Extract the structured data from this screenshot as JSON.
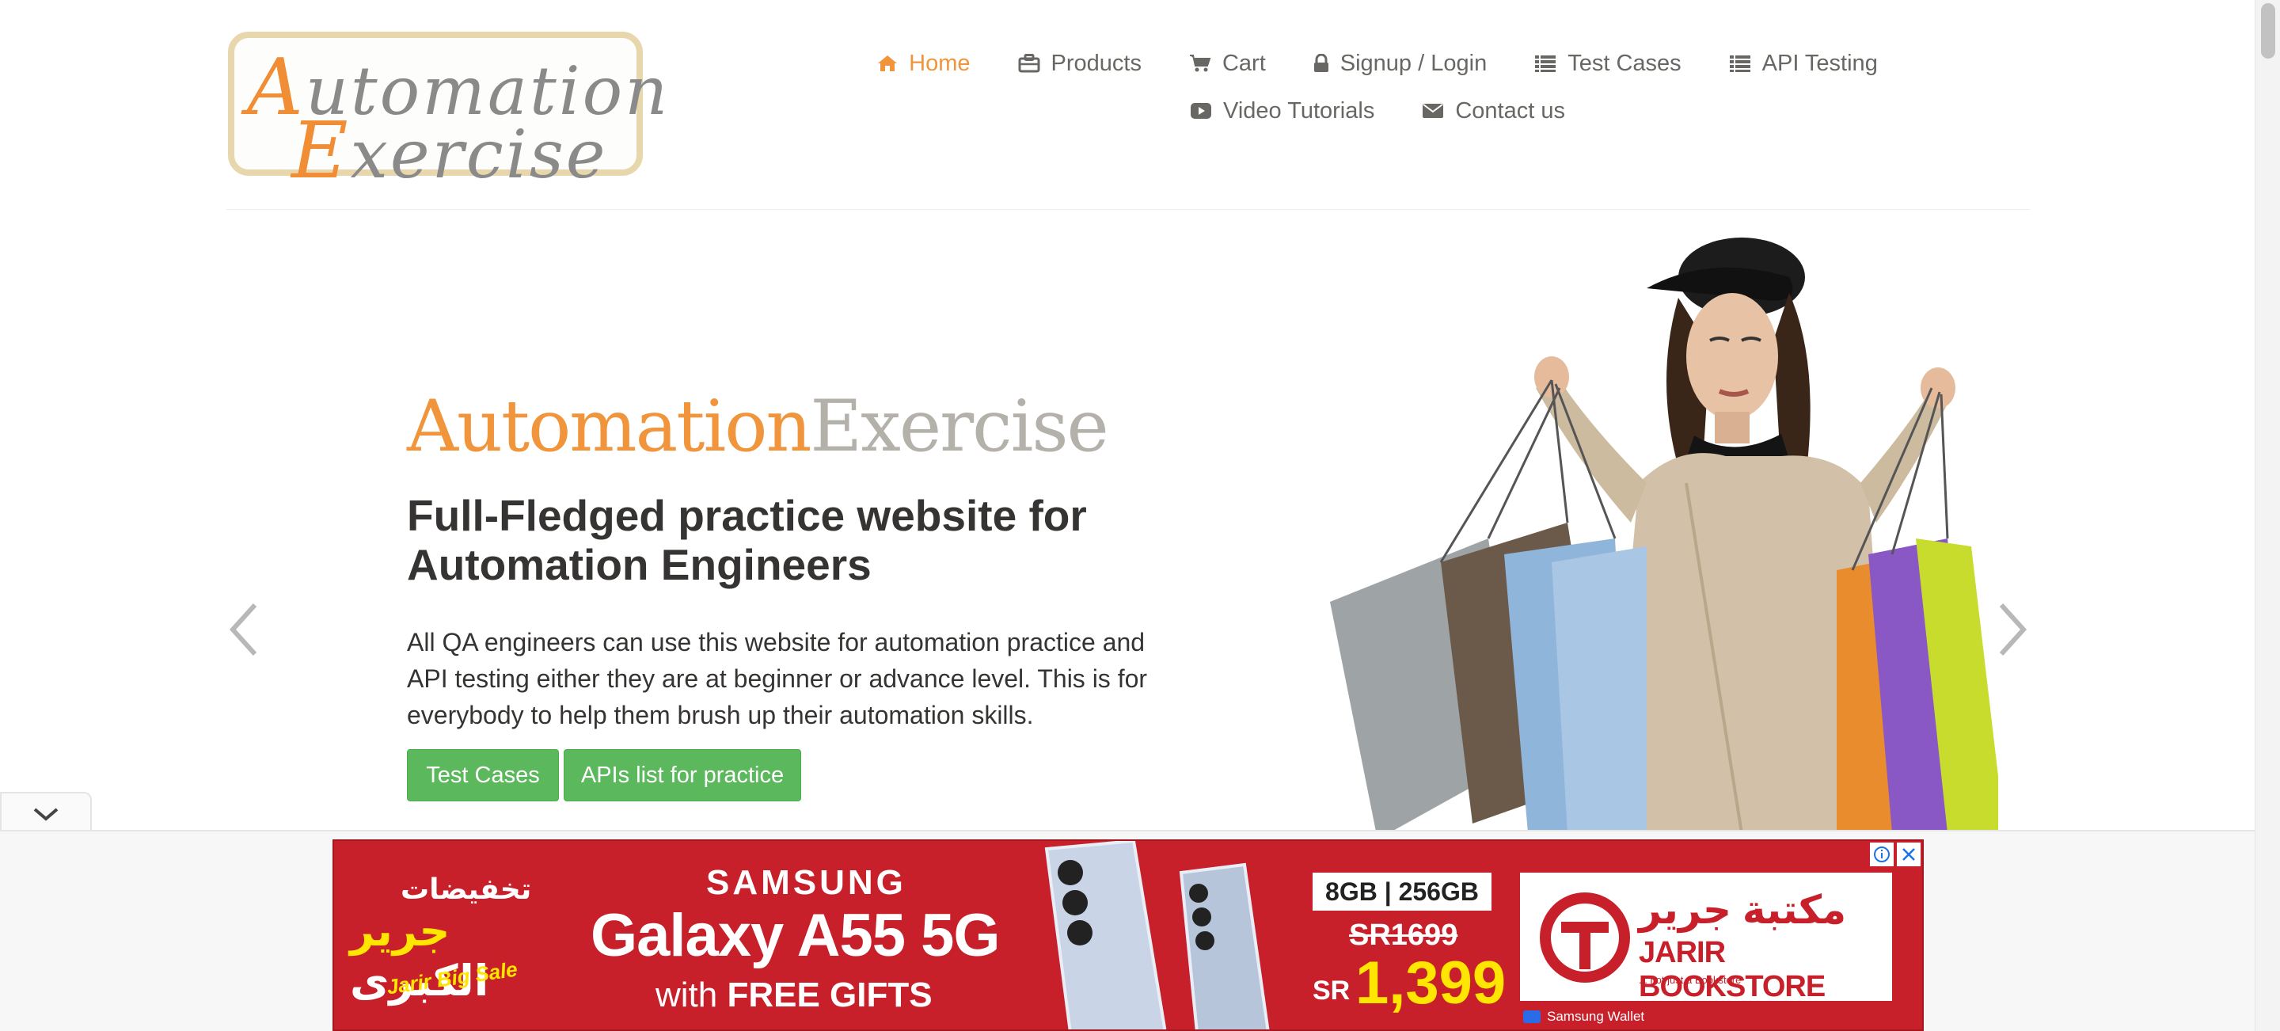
{
  "logo": {
    "line1_cap": "A",
    "line1_rest": "utomation",
    "line2_cap": "E",
    "line2_rest": "xercise"
  },
  "nav": {
    "row1": [
      {
        "label": "Home",
        "icon": "home-icon",
        "active": true
      },
      {
        "label": "Products",
        "icon": "briefcase-icon"
      },
      {
        "label": "Cart",
        "icon": "cart-icon"
      },
      {
        "label": "Signup / Login",
        "icon": "lock-icon"
      },
      {
        "label": "Test Cases",
        "icon": "list-icon"
      },
      {
        "label": "API Testing",
        "icon": "list-icon"
      }
    ],
    "row2": [
      {
        "label": "Video Tutorials",
        "icon": "youtube-icon"
      },
      {
        "label": "Contact us",
        "icon": "envelope-icon"
      }
    ]
  },
  "hero": {
    "title_a": "Automation",
    "title_b": "Exercise",
    "heading": "Full-Fledged practice website for Automation Engineers",
    "paragraph": "All QA engineers can use this website for automation practice and API testing either they are at beginner or advance level. This is for everybody to help them brush up their automation skills.",
    "btn_test_cases": "Test Cases",
    "btn_apis": "APIs list for practice"
  },
  "ad": {
    "sale_ar1": "تخفيضات",
    "sale_ar2a": "جرير",
    "sale_ar2b": " الكبرى",
    "sale_en": "Jarir Big Sale",
    "brand": "SAMSUNG",
    "model": "Galaxy A55 5G",
    "gift_prefix": "with ",
    "gift_bold": "FREE GIFTS",
    "spec": "8GB | 256GB",
    "old_price": "SR1699",
    "currency": "SR",
    "price": "1,399",
    "jarir_ar": "مكتبة جرير",
    "jarir_name": "JARIR BOOKSTORE",
    "jarir_tag": "... not just a Bookstore",
    "wallet": "Samsung Wallet"
  },
  "colors": {
    "accent": "#f0953c",
    "button": "#5cb85c",
    "nav_text": "#696763",
    "ad_red": "#c8202a"
  }
}
